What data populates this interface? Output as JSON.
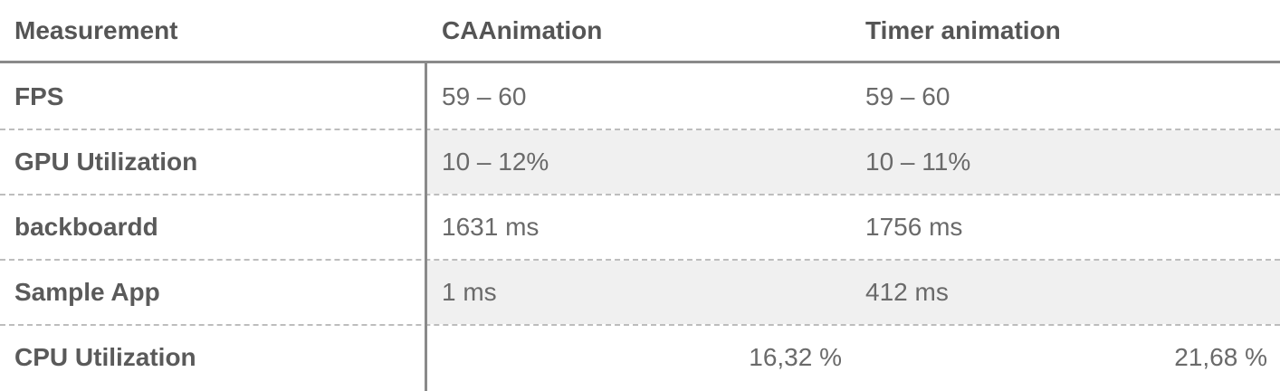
{
  "headers": {
    "measurement": "Measurement",
    "caanimation": "CAAnimation",
    "timer": "Timer animation"
  },
  "rows": [
    {
      "label": "FPS",
      "ca": "59 – 60",
      "timer": "59 – 60"
    },
    {
      "label": "GPU Utilization",
      "ca": "10 – 12%",
      "timer": "10 – 11%"
    },
    {
      "label": "backboardd",
      "ca": "1631 ms",
      "timer": "1756 ms"
    },
    {
      "label": "Sample App",
      "ca": "1 ms",
      "timer": "412 ms"
    },
    {
      "label": "CPU Utilization",
      "ca": "16,32 %",
      "timer": "21,68 %"
    }
  ],
  "colors": {
    "row_shade": "#f0f0f0",
    "rule": "#8a8a8a",
    "text": "#555555"
  }
}
